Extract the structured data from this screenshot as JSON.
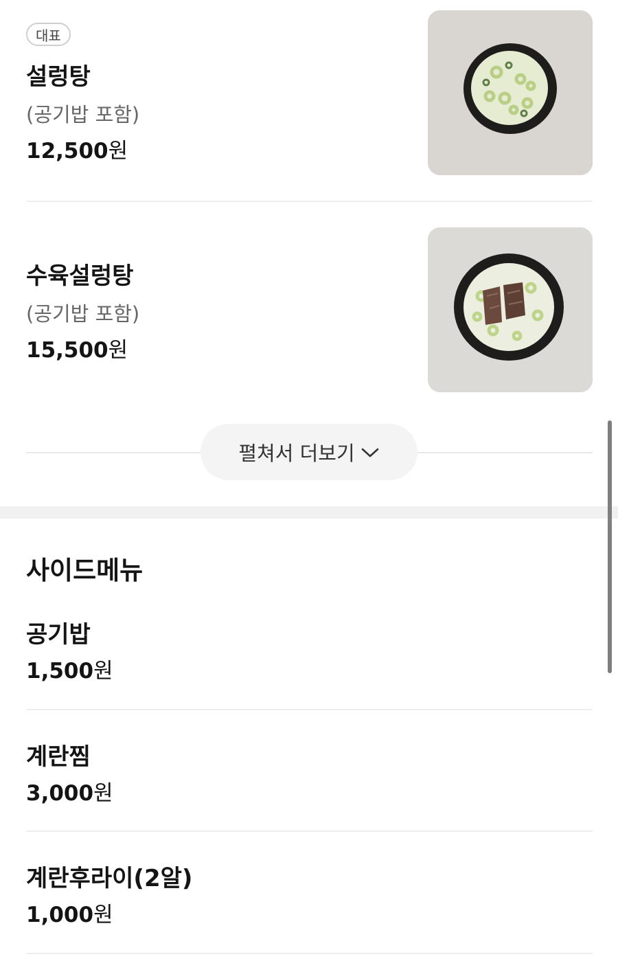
{
  "main_menu": [
    {
      "badge": "대표",
      "name": "설렁탕",
      "description": "(공기밥 포함)",
      "price_number": "12,500",
      "price_unit": "원"
    },
    {
      "name": "수육설렁탕",
      "description": "(공기밥 포함)",
      "price_number": "15,500",
      "price_unit": "원"
    }
  ],
  "expand_button": {
    "label": "펼쳐서 더보기",
    "icon": "chevron-down-icon"
  },
  "side_menu": {
    "title": "사이드메뉴",
    "items": [
      {
        "name": "공기밥",
        "price_number": "1,500",
        "price_unit": "원"
      },
      {
        "name": "계란찜",
        "price_number": "3,000",
        "price_unit": "원"
      },
      {
        "name": "계란후라이(2알)",
        "price_number": "1,000",
        "price_unit": "원"
      }
    ]
  },
  "colors": {
    "text_primary": "#141414",
    "text_secondary": "#666666",
    "divider": "#eeeeee",
    "button_bg": "#f4f4f4"
  }
}
